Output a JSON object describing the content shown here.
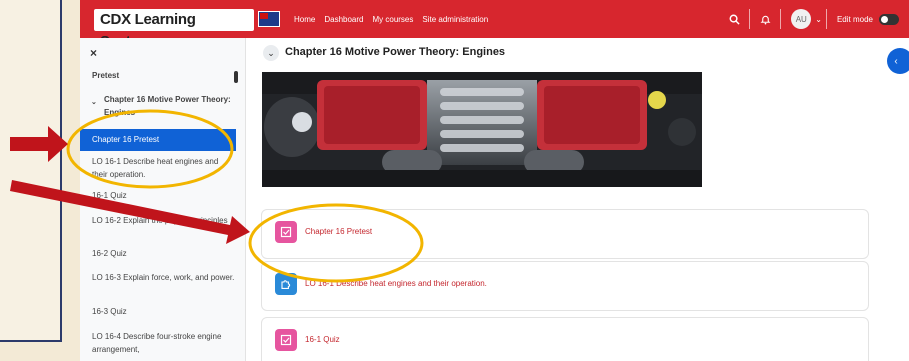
{
  "navbar": {
    "brand": "CDX Learning Systems",
    "links": [
      "Home",
      "Dashboard",
      "My courses",
      "Site administration"
    ],
    "avatar_initials": "AU",
    "edit_mode_label": "Edit mode"
  },
  "sidebar": {
    "close_label": "×",
    "items": {
      "pretest_top": "Pretest",
      "section": "Chapter 16 Motive Power Theory: Engines",
      "active": "Chapter 16 Pretest",
      "lo161": "LO 16-1 Describe heat engines and their operation.",
      "q161": "16-1 Quiz",
      "lo162": "LO 16-2 Explain the physics principles",
      "q162": "16-2 Quiz",
      "lo163": "LO 16-3 Explain force, work, and power.",
      "q163": "16-3 Quiz",
      "lo164": "LO 16-4 Describe four-stroke engine arrangement,"
    }
  },
  "main": {
    "chapter_title": "Chapter 16 Motive Power Theory: Engines",
    "activities": {
      "pretest": "Chapter 16 Pretest",
      "lo161": "LO 16-1 Describe heat engines and their operation.",
      "quiz161": "16-1 Quiz"
    }
  },
  "colors": {
    "navbar": "#d7262e",
    "active": "#1062d6",
    "link": "#c4272e",
    "quiz_icon": "#e6559f",
    "page_icon": "#2a8ad8",
    "highlight": "#f2b500",
    "arrow": "#c0141b"
  }
}
